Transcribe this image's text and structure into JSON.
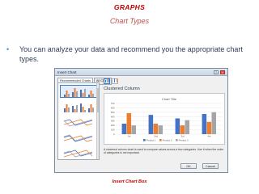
{
  "slide": {
    "title": "GRAPHS",
    "subtitle": "Chart Types",
    "bullet": "You can analyze your data and recommend you the appropriate chart types.",
    "caption": "Insert Chart Box",
    "colors": {
      "title": "#c00000",
      "subtitle": "#c0504d",
      "bullet_dot": "#2d9ad1",
      "text": "#2e3c53"
    }
  },
  "dialog": {
    "title": "Insert Chart",
    "controls": {
      "help": "?",
      "close": "×"
    },
    "tabs": [
      {
        "label": "Recommended Charts",
        "active": true
      },
      {
        "label": "All Charts",
        "active": false
      }
    ],
    "chart_type_name": "Clustered Column",
    "description": "A clustered column chart is used to compare values across a few categories. Use it when the order of categories is not important.",
    "buttons": {
      "ok": "OK",
      "cancel": "Cancel"
    },
    "thumbnails": [
      {
        "icon": "clustered-column-thumbnail",
        "selected": true
      },
      {
        "icon": "column-thumbnail",
        "selected": false
      },
      {
        "icon": "line-thumbnail",
        "selected": false
      },
      {
        "icon": "area-thumbnail",
        "selected": false
      },
      {
        "icon": "line-curve-thumbnail",
        "selected": false
      }
    ],
    "type_icons": [
      "clustered-column-icon",
      "stacked-column-icon"
    ]
  },
  "chart_data": {
    "type": "bar",
    "title": "Chart Title",
    "categories": [
      "1st",
      "2nd",
      "3rd",
      "4th"
    ],
    "series": [
      {
        "name": "Product 1",
        "color": "#4472c4",
        "values": [
          240,
          440,
          360,
          460
        ]
      },
      {
        "name": "Product 2",
        "color": "#ed7d31",
        "values": [
          480,
          240,
          200,
          280
        ]
      },
      {
        "name": "Product 3",
        "color": "#a5a5a5",
        "values": [
          200,
          200,
          320,
          500
        ]
      }
    ],
    "ylim": [
      0,
      700
    ],
    "yticks": [
      "0",
      "100",
      "200",
      "300",
      "400",
      "500",
      "600",
      "700"
    ],
    "grid": true,
    "legend": "bottom"
  }
}
